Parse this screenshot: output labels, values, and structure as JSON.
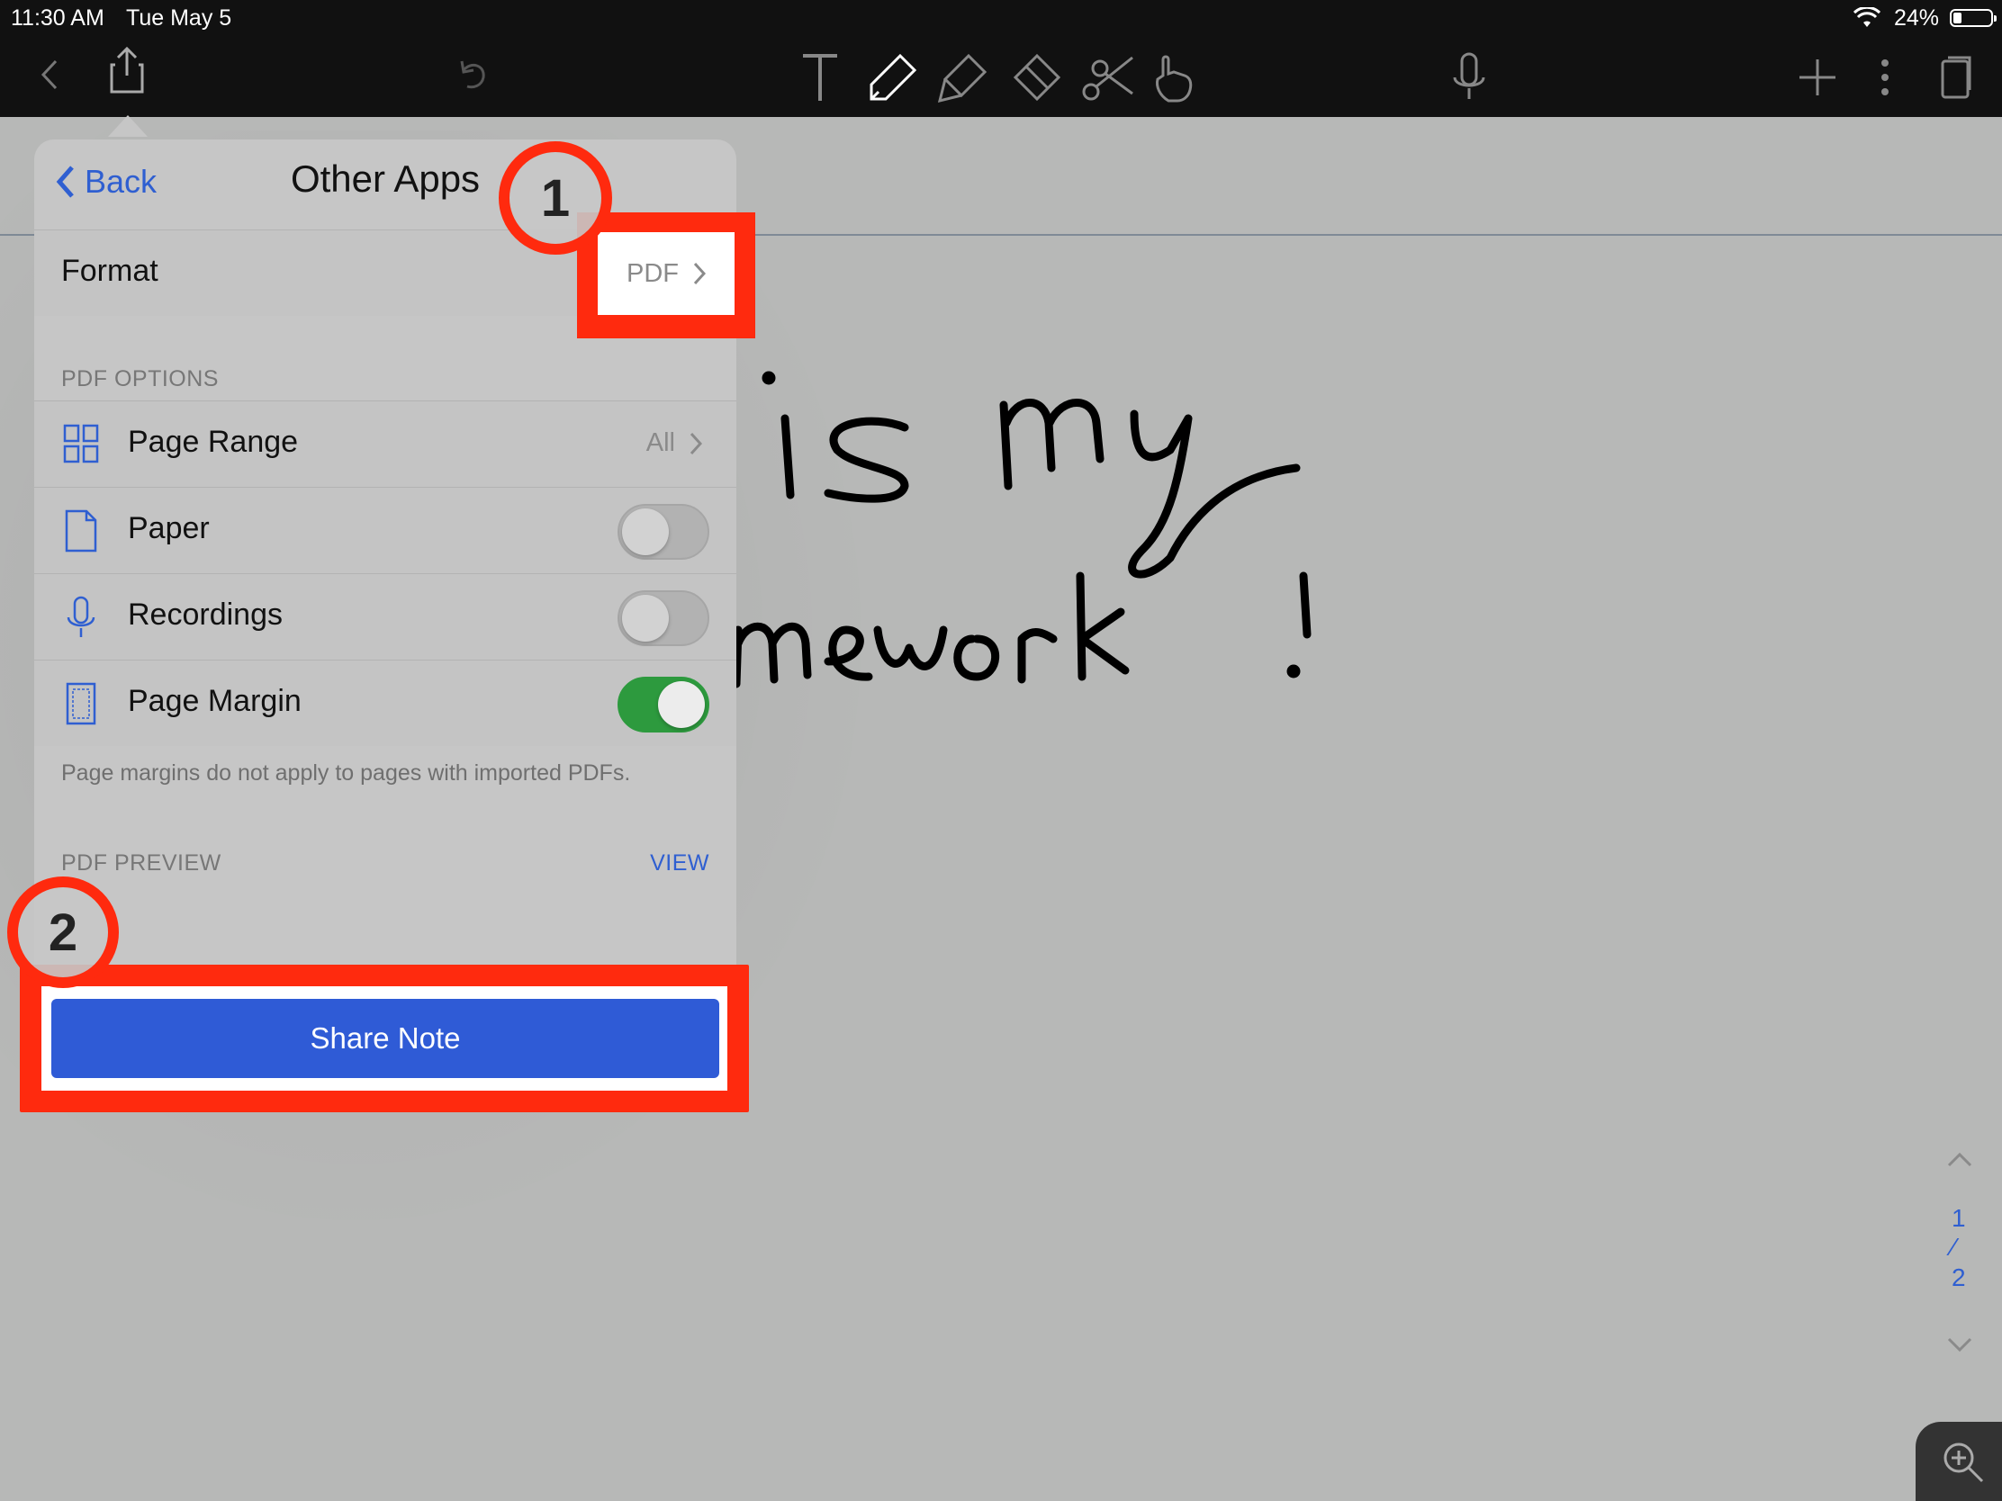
{
  "status": {
    "time": "11:30 AM",
    "date": "Tue May 5",
    "battery": "24%"
  },
  "toolbar": {
    "icons": [
      "back-chevron-icon",
      "share-icon",
      "undo-icon",
      "text-tool-icon",
      "pen-icon",
      "highlighter-icon",
      "eraser-icon",
      "scissors-icon",
      "hand-pointer-icon",
      "microphone-icon",
      "plus-icon",
      "more-icon",
      "pages-icon"
    ]
  },
  "popover": {
    "back_label": "Back",
    "title": "Other Apps",
    "format": {
      "label": "Format",
      "value": "PDF"
    },
    "pdf_options_header": "PDF OPTIONS",
    "options": [
      {
        "label": "Page Range",
        "value": "All",
        "icon": "grid-icon"
      },
      {
        "label": "Paper",
        "toggle": false,
        "icon": "document-icon"
      },
      {
        "label": "Recordings",
        "toggle": false,
        "icon": "microphone-icon"
      },
      {
        "label": "Page Margin",
        "toggle": true,
        "icon": "page-margin-icon"
      }
    ],
    "footnote": "Page margins do not apply to pages with imported PDFs.",
    "pdf_preview_header": "PDF PREVIEW",
    "view_label": "VIEW",
    "share_label": "Share Note"
  },
  "callouts": {
    "first": "1",
    "second": "2"
  },
  "note": {
    "handwriting_line1": "is my",
    "handwriting_line2": "mework !"
  },
  "pager": {
    "current": "1",
    "separator": "⁄",
    "total": "2"
  },
  "colors": {
    "accent": "#2f5fd1",
    "share_button": "#2f5bd6",
    "highlight": "#ff2a0e",
    "toggle_on": "#2d9a3e"
  }
}
